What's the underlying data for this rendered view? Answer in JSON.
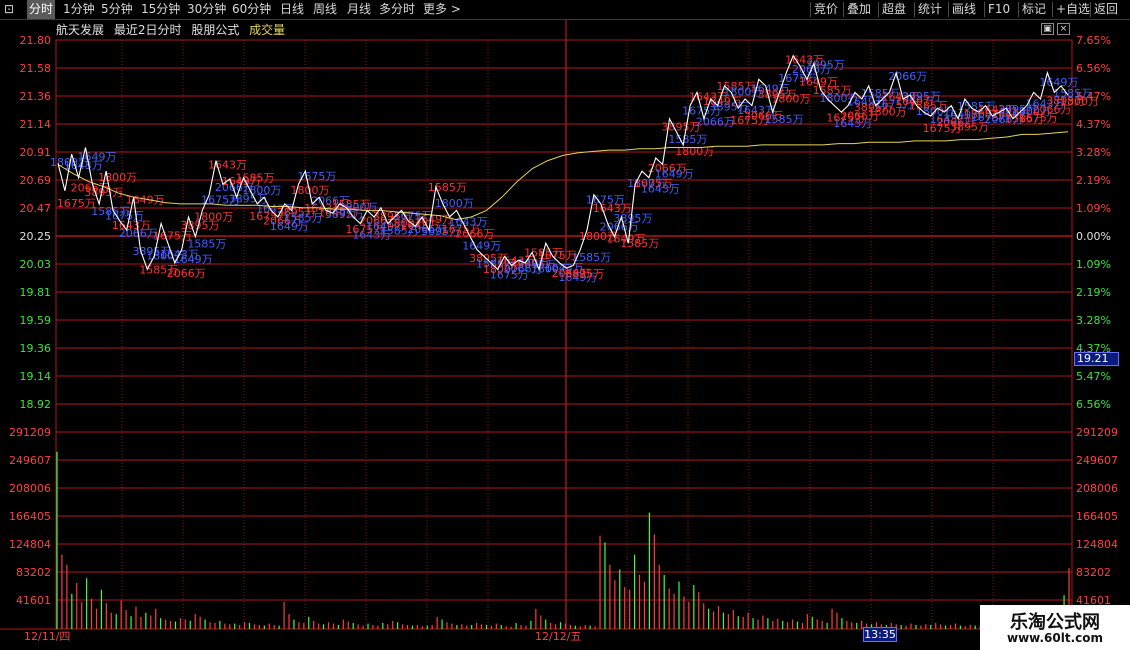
{
  "toolbar": {
    "items": [
      "分时",
      "1分钟",
      "5分钟",
      "15分钟",
      "30分钟",
      "60分钟",
      "日线",
      "周线",
      "月线",
      "多分时",
      "更多 >"
    ],
    "right_items": [
      "竞价",
      "叠加",
      "超盘",
      "统计",
      "画线",
      "F10",
      "标记",
      "+自选",
      "返回"
    ],
    "active_index": 0
  },
  "title": {
    "stock": "航天发展",
    "mode": "最近2日分时",
    "formula": "股朋公式",
    "volume": "成交量"
  },
  "chart_data": [
    {
      "type": "line",
      "name_hint": "intraday-price",
      "y_ticks_left": [
        "21.80",
        "21.58",
        "21.36",
        "21.14",
        "20.91",
        "20.69",
        "20.47",
        "20.25",
        "20.03",
        "19.81",
        "19.59",
        "19.36",
        "19.14",
        "18.92"
      ],
      "y_ticks_right": [
        "7.65%",
        "6.56%",
        "5.47%",
        "4.37%",
        "3.28%",
        "2.19%",
        "1.09%",
        "0.00%",
        "1.09%",
        "2.19%",
        "3.28%",
        "4.37%",
        "5.47%",
        "6.56%"
      ],
      "ylim": [
        18.81,
        21.8
      ],
      "base_price": 20.25,
      "x_ticks": [
        "12/11/四",
        "12/12/五"
      ],
      "price_series": [
        20.86,
        20.65,
        20.93,
        20.75,
        20.98,
        20.7,
        20.55,
        20.8,
        20.5,
        20.42,
        20.35,
        20.6,
        20.2,
        20.05,
        20.15,
        20.4,
        20.25,
        20.1,
        20.2,
        20.45,
        20.3,
        20.5,
        20.62,
        20.88,
        20.7,
        20.74,
        20.6,
        20.75,
        20.65,
        20.55,
        20.6,
        20.5,
        20.45,
        20.55,
        20.5,
        20.7,
        20.8,
        20.55,
        20.6,
        20.5,
        20.48,
        20.55,
        20.52,
        20.45,
        20.4,
        20.5,
        20.45,
        20.52,
        20.4,
        20.45,
        20.5,
        20.42,
        20.38,
        20.45,
        20.35,
        20.68,
        20.55,
        20.45,
        20.5,
        20.4,
        20.3,
        20.2,
        20.15,
        20.1,
        20.05,
        20.15,
        20.08,
        20.12,
        20.1,
        20.18,
        20.05,
        20.25,
        20.15,
        20.1,
        20.06,
        20.08,
        20.2,
        20.35,
        20.62,
        20.55,
        20.4,
        20.3,
        20.45,
        20.25,
        20.7,
        20.8,
        20.75,
        20.9,
        20.85,
        21.2,
        21.1,
        21.0,
        21.3,
        21.4,
        21.2,
        21.35,
        21.3,
        21.45,
        21.4,
        21.28,
        21.35,
        21.3,
        21.5,
        21.45,
        21.25,
        21.4,
        21.55,
        21.68,
        21.6,
        21.5,
        21.62,
        21.42,
        21.35,
        21.3,
        21.25,
        21.3,
        21.4,
        21.35,
        21.45,
        21.3,
        21.35,
        21.4,
        21.55,
        21.35,
        21.38,
        21.3,
        21.25,
        21.22,
        21.28,
        21.25,
        21.3,
        21.2,
        21.35,
        21.28,
        21.25,
        21.3,
        21.22,
        21.25,
        21.28,
        21.2,
        21.25,
        21.3,
        21.4,
        21.35,
        21.55,
        21.4,
        21.45,
        21.38
      ],
      "avg_series": [
        20.85,
        20.78,
        20.72,
        20.68,
        20.63,
        20.6,
        20.58,
        20.56,
        20.55,
        20.55,
        20.55,
        20.54,
        20.54,
        20.54,
        20.53,
        20.53,
        20.52,
        20.52,
        20.51,
        20.51,
        20.5,
        20.5,
        20.49,
        20.48,
        20.47,
        20.46,
        20.43,
        20.45,
        20.5,
        20.6,
        20.72,
        20.82,
        20.88,
        20.92,
        20.94,
        20.95,
        20.96,
        20.96,
        20.97,
        20.97,
        20.98,
        20.98,
        20.98,
        20.99,
        20.99,
        20.99,
        21.0,
        21.0,
        21.0,
        21.0,
        21.0,
        21.01,
        21.01,
        21.02,
        21.02,
        21.02,
        21.03,
        21.03,
        21.03,
        21.04,
        21.04,
        21.05,
        21.06,
        21.08,
        21.08,
        21.09,
        21.1
      ],
      "marker_labels": [
        "1800万",
        "1675万",
        "1643万",
        "2066万",
        "1649万",
        "3895万",
        "1585万"
      ]
    },
    {
      "type": "bar",
      "name_hint": "volume",
      "y_ticks": [
        "291209",
        "249607",
        "208006",
        "166405",
        "124804",
        "83202",
        "41601"
      ],
      "ylim": [
        0,
        291209
      ],
      "volume_series": [
        262000,
        110000,
        95000,
        52000,
        68000,
        40000,
        75000,
        45000,
        30000,
        58000,
        38000,
        24000,
        22000,
        42000,
        28000,
        19000,
        33000,
        18000,
        24000,
        20000,
        30000,
        16000,
        14000,
        12000,
        11000,
        16000,
        14000,
        12000,
        22000,
        18000,
        14000,
        10000,
        9000,
        12000,
        8000,
        7000,
        8000,
        6000,
        10000,
        9000,
        7000,
        6000,
        5000,
        8000,
        6000,
        5000,
        40000,
        22000,
        14000,
        10000,
        9000,
        18000,
        12000,
        8000,
        7000,
        10000,
        8000,
        6000,
        14000,
        11000,
        9000,
        7000,
        5000,
        8000,
        6000,
        5000,
        9000,
        7000,
        12000,
        10000,
        7000,
        6000,
        5000,
        6000,
        4000,
        5000,
        6000,
        18000,
        14000,
        10000,
        8000,
        6000,
        7000,
        5000,
        6000,
        9000,
        7000,
        6000,
        5000,
        8000,
        6000,
        4000,
        3000,
        9000,
        6000,
        5000,
        12000,
        30000,
        20000,
        14000,
        9000,
        7000,
        10000,
        8000,
        6000,
        5000,
        4000,
        6000,
        5000,
        4000,
        138000,
        128000,
        95000,
        72000,
        88000,
        62000,
        58000,
        110000,
        80000,
        70000,
        172000,
        140000,
        95000,
        80000,
        60000,
        52000,
        70000,
        48000,
        40000,
        65000,
        55000,
        38000,
        30000,
        26000,
        34000,
        24000,
        22000,
        28000,
        19000,
        18000,
        24000,
        16000,
        14000,
        20000,
        16000,
        12000,
        15000,
        12000,
        10000,
        14000,
        11000,
        9000,
        22000,
        18000,
        14000,
        12000,
        9000,
        30000,
        24000,
        16000,
        12000,
        10000,
        9000,
        12000,
        8000,
        7000,
        10000,
        7000,
        6000,
        9000,
        7000,
        6000,
        5000,
        8000,
        6000,
        5000,
        7000,
        6000,
        9000,
        7000,
        5000,
        6000,
        8000,
        5000,
        4000,
        6000,
        5000,
        4000,
        7000,
        5000,
        4000,
        6000,
        5000,
        4000,
        6000,
        5000,
        4000,
        5000,
        6000,
        4000,
        5000,
        6000,
        5000,
        4000,
        50000,
        90000
      ]
    }
  ],
  "cursor": {
    "time": "13:35",
    "price": "19.21"
  },
  "watermark": {
    "name": "乐淘公式网",
    "url": "www.60lt.com"
  },
  "colors": {
    "up": "#ff3c3c",
    "down": "#3cff3c",
    "price_line": "#ffffff",
    "avg_line": "#e6d35a",
    "grid": "#b01818",
    "label_blue": "#4060ff",
    "label_red": "#ff3030"
  }
}
